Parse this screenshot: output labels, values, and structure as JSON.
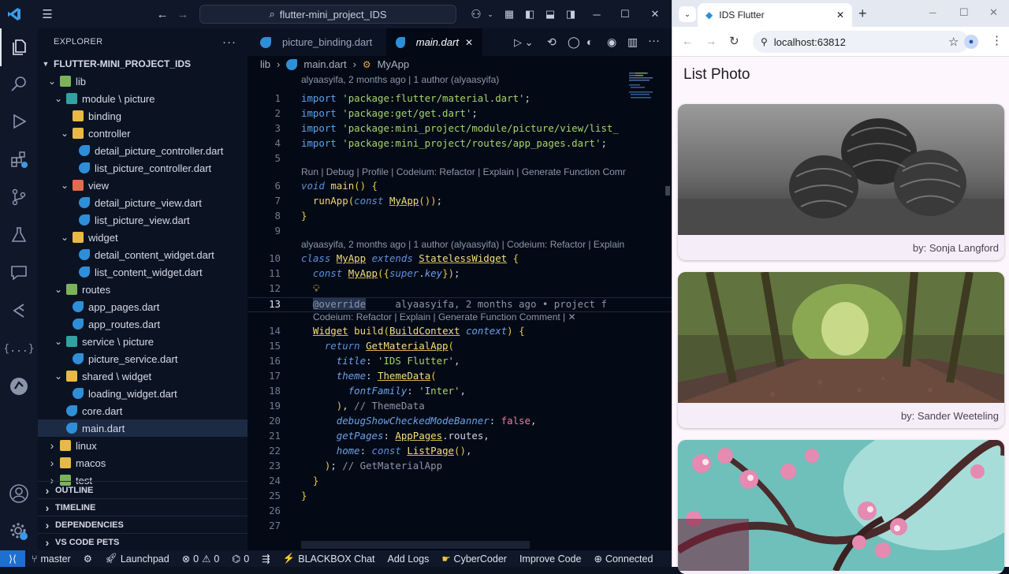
{
  "vscode": {
    "search_label": "flutter-mini_project_IDS",
    "explorer_title": "EXPLORER",
    "project_name": "FLUTTER-MINI_PROJECT_IDS",
    "tree": [
      {
        "label": "lib",
        "depth": 1,
        "kind": "folder-g",
        "open": true
      },
      {
        "label": "module \\ picture",
        "depth": 2,
        "kind": "folder-t",
        "open": true
      },
      {
        "label": "binding",
        "depth": 3,
        "kind": "folder",
        "open": false,
        "nochev": true
      },
      {
        "label": "controller",
        "depth": 3,
        "kind": "folder",
        "open": true
      },
      {
        "label": "detail_picture_controller.dart",
        "depth": 4,
        "kind": "dart"
      },
      {
        "label": "list_picture_controller.dart",
        "depth": 4,
        "kind": "dart"
      },
      {
        "label": "view",
        "depth": 3,
        "kind": "folder-r",
        "open": true
      },
      {
        "label": "detail_picture_view.dart",
        "depth": 4,
        "kind": "dart"
      },
      {
        "label": "list_picture_view.dart",
        "depth": 4,
        "kind": "dart"
      },
      {
        "label": "widget",
        "depth": 3,
        "kind": "folder",
        "open": true
      },
      {
        "label": "detail_content_widget.dart",
        "depth": 4,
        "kind": "dart"
      },
      {
        "label": "list_content_widget.dart",
        "depth": 4,
        "kind": "dart"
      },
      {
        "label": "routes",
        "depth": 2,
        "kind": "folder-g",
        "open": true
      },
      {
        "label": "app_pages.dart",
        "depth": 3,
        "kind": "dart"
      },
      {
        "label": "app_routes.dart",
        "depth": 3,
        "kind": "dart"
      },
      {
        "label": "service \\ picture",
        "depth": 2,
        "kind": "folder-t",
        "open": true
      },
      {
        "label": "picture_service.dart",
        "depth": 3,
        "kind": "dart"
      },
      {
        "label": "shared \\ widget",
        "depth": 2,
        "kind": "folder",
        "open": true
      },
      {
        "label": "loading_widget.dart",
        "depth": 3,
        "kind": "dart"
      },
      {
        "label": "core.dart",
        "depth": 2,
        "kind": "dart"
      },
      {
        "label": "main.dart",
        "depth": 2,
        "kind": "dart",
        "selected": true
      },
      {
        "label": "linux",
        "depth": 1,
        "kind": "folder",
        "open": false
      },
      {
        "label": "macos",
        "depth": 1,
        "kind": "folder",
        "open": false
      },
      {
        "label": "test",
        "depth": 1,
        "kind": "folder-g",
        "open": false
      }
    ],
    "sections": [
      "OUTLINE",
      "TIMELINE",
      "DEPENDENCIES",
      "VS CODE PETS"
    ],
    "tabs": [
      {
        "label": "picture_binding.dart",
        "active": false
      },
      {
        "label": "main.dart",
        "active": true
      }
    ],
    "breadcrumb": {
      "folder": "lib",
      "file": "main.dart",
      "symbol": "MyApp"
    },
    "blame_top": "alyaasyifa, 2 months ago | 1 author (alyaasyifa)",
    "lens_main": "Run | Debug | Profile | Codeium: Refactor | Explain | Generate Function Comme",
    "lens_class": "alyaasyifa, 2 months ago | 1 author (alyaasyifa) | Codeium: Refactor | Explain",
    "lens_build": "Codeium: Refactor | Explain | Generate Function Comment | ✕",
    "inline_blame": "alyaasyifa, 2 months ago • project f",
    "line_numbers": [
      "1",
      "2",
      "3",
      "4",
      "5",
      "6",
      "7",
      "8",
      "9",
      "10",
      "11",
      "12",
      "13",
      "14",
      "15",
      "16",
      "17",
      "18",
      "19",
      "20",
      "21",
      "22",
      "23",
      "24",
      "25",
      "26",
      "27"
    ],
    "status": {
      "branch": "master",
      "launchpad": "Launchpad",
      "errors": "0",
      "warnings": "0",
      "ports": "0",
      "blackbox": "BLACKBOX Chat",
      "add_logs": "Add Logs",
      "cybercoder": "CyberCoder",
      "improve": "Improve Code",
      "connected": "Connected"
    }
  },
  "browser": {
    "tab_title": "IDS Flutter",
    "url": "localhost:63812",
    "app_title": "List Photo",
    "cards": [
      {
        "caption": "by: Sonja Langford",
        "image": "pinecones-grayscale"
      },
      {
        "caption": "by: Sander Weeteling",
        "image": "forest-path"
      },
      {
        "caption": "",
        "image": "pink-blossoms"
      }
    ]
  }
}
